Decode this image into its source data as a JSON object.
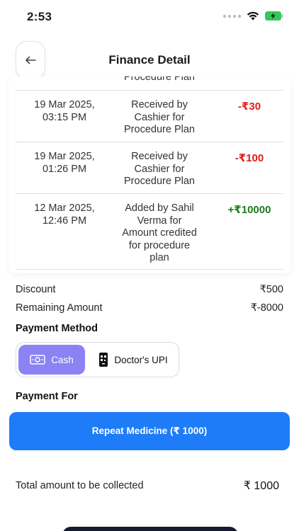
{
  "status_bar": {
    "time": "2:53"
  },
  "header": {
    "title": "Finance Detail"
  },
  "transactions": {
    "partial_top_text": "Procedure Plan",
    "rows": [
      {
        "date": "19 Mar 2025,\n03:15 PM",
        "description": "Received by\nCashier for\nProcedure Plan",
        "amount": "-₹30",
        "type": "debit"
      },
      {
        "date": "19 Mar 2025,\n01:26 PM",
        "description": "Received by\nCashier for\nProcedure Plan",
        "amount": "-₹100",
        "type": "debit"
      },
      {
        "date": "12 Mar 2025,\n12:46 PM",
        "description": "Added by Sahil\nVerma for\nAmount credited\nfor procedure\nplan",
        "amount": "+₹10000",
        "type": "credit"
      }
    ]
  },
  "summary": {
    "discount_label": "Discount",
    "discount_value": "₹500",
    "remaining_label": "Remaining Amount",
    "remaining_value": "₹-8000"
  },
  "payment_method": {
    "title": "Payment Method",
    "options": [
      {
        "label": "Cash",
        "icon": "cash-icon",
        "selected": true
      },
      {
        "label": "Doctor's UPI",
        "icon": "qr-phone-icon",
        "selected": false
      }
    ]
  },
  "payment_for": {
    "title": "Payment For",
    "button_label": "Repeat Medicine (₹ 1000)"
  },
  "total": {
    "label": "Total amount to be collected",
    "value": "₹ 1000"
  },
  "colors": {
    "accent_blue": "#1e7cf8",
    "cash_selected": "#8b83f4",
    "debit": "#e21a1a",
    "credit": "#1c7a1c"
  }
}
